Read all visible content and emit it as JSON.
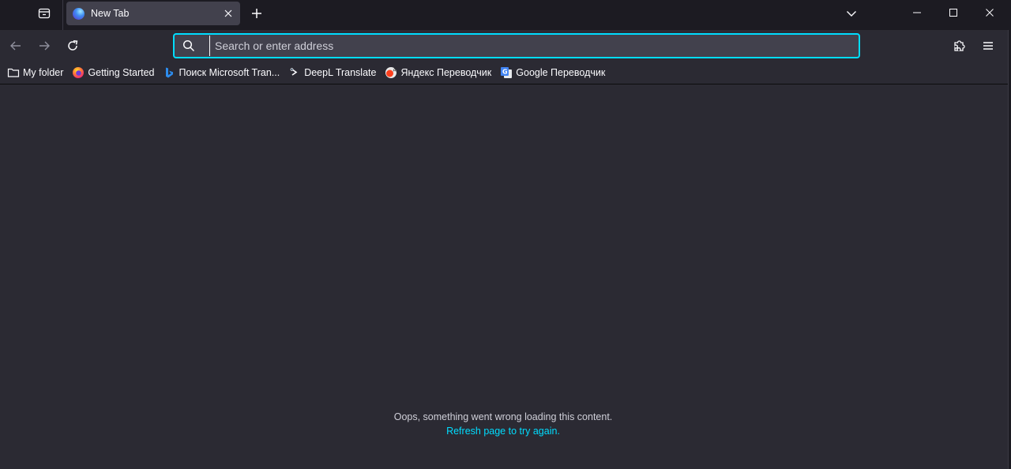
{
  "tabs": [
    {
      "title": "New Tab",
      "favicon": "firefox-globe-icon"
    }
  ],
  "tabbar": {
    "tab_manager_icon": "tab-manager-icon",
    "new_tab_icon": "plus-icon",
    "list_all_tabs_icon": "chevron-down-icon"
  },
  "window_controls": [
    "minimize-icon",
    "maximize-icon",
    "close-icon"
  ],
  "navbar": {
    "back_icon": "arrow-left-icon",
    "forward_icon": "arrow-right-icon",
    "reload_icon": "reload-icon",
    "search_icon": "search-icon",
    "url_placeholder": "Search or enter address",
    "url_value": "",
    "extensions_icon": "puzzle-icon",
    "menu_icon": "hamburger-icon"
  },
  "bookmarks": [
    {
      "label": "My folder",
      "icon": "folder-icon"
    },
    {
      "label": "Getting Started",
      "icon": "firefox-icon"
    },
    {
      "label": "Поиск Microsoft Tran...",
      "icon": "bing-icon"
    },
    {
      "label": "DeepL Translate",
      "icon": "deepl-icon"
    },
    {
      "label": "Яндекс Переводчик",
      "icon": "yandex-translate-icon"
    },
    {
      "label": "Google Переводчик",
      "icon": "google-translate-icon"
    }
  ],
  "content": {
    "error_message": "Oops, something went wrong loading this content.",
    "retry_link": "Refresh page to try again."
  },
  "colors": {
    "tabbar_bg": "#1c1b22",
    "toolbar_bg": "#2b2a33",
    "urlbar_bg": "#42414d",
    "focus_ring": "#00ddff",
    "link": "#00ddff",
    "text": "#fbfbfe"
  }
}
